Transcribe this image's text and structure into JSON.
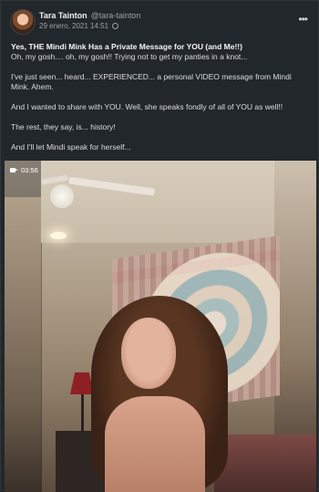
{
  "post": {
    "author_name": "Tara Tainton",
    "author_handle": "@tara-tainton",
    "date": "29 enero, 2021 14:51",
    "more_menu": "•••",
    "title": "Yes, THE Mindi Mink Has a Private Message for YOU (and Me!!)",
    "paragraphs": [
      "Oh, my gosh.... oh, my gosh!! Trying not to get my panties in a knot...",
      "I've just seen... heard... EXPERIENCED... a personal VIDEO message from Mindi Mink. Ahem.",
      "And I wanted to share with YOU. Well, she speaks fondly of all of YOU as well!!",
      "The rest, they say, is... history!",
      "And I'll let Mindi speak for herself..."
    ],
    "video_duration": "03:56"
  },
  "icons": {
    "avatar": "avatar",
    "visibility": "globe-icon",
    "menu": "more-icon",
    "video": "video-camera-icon"
  }
}
